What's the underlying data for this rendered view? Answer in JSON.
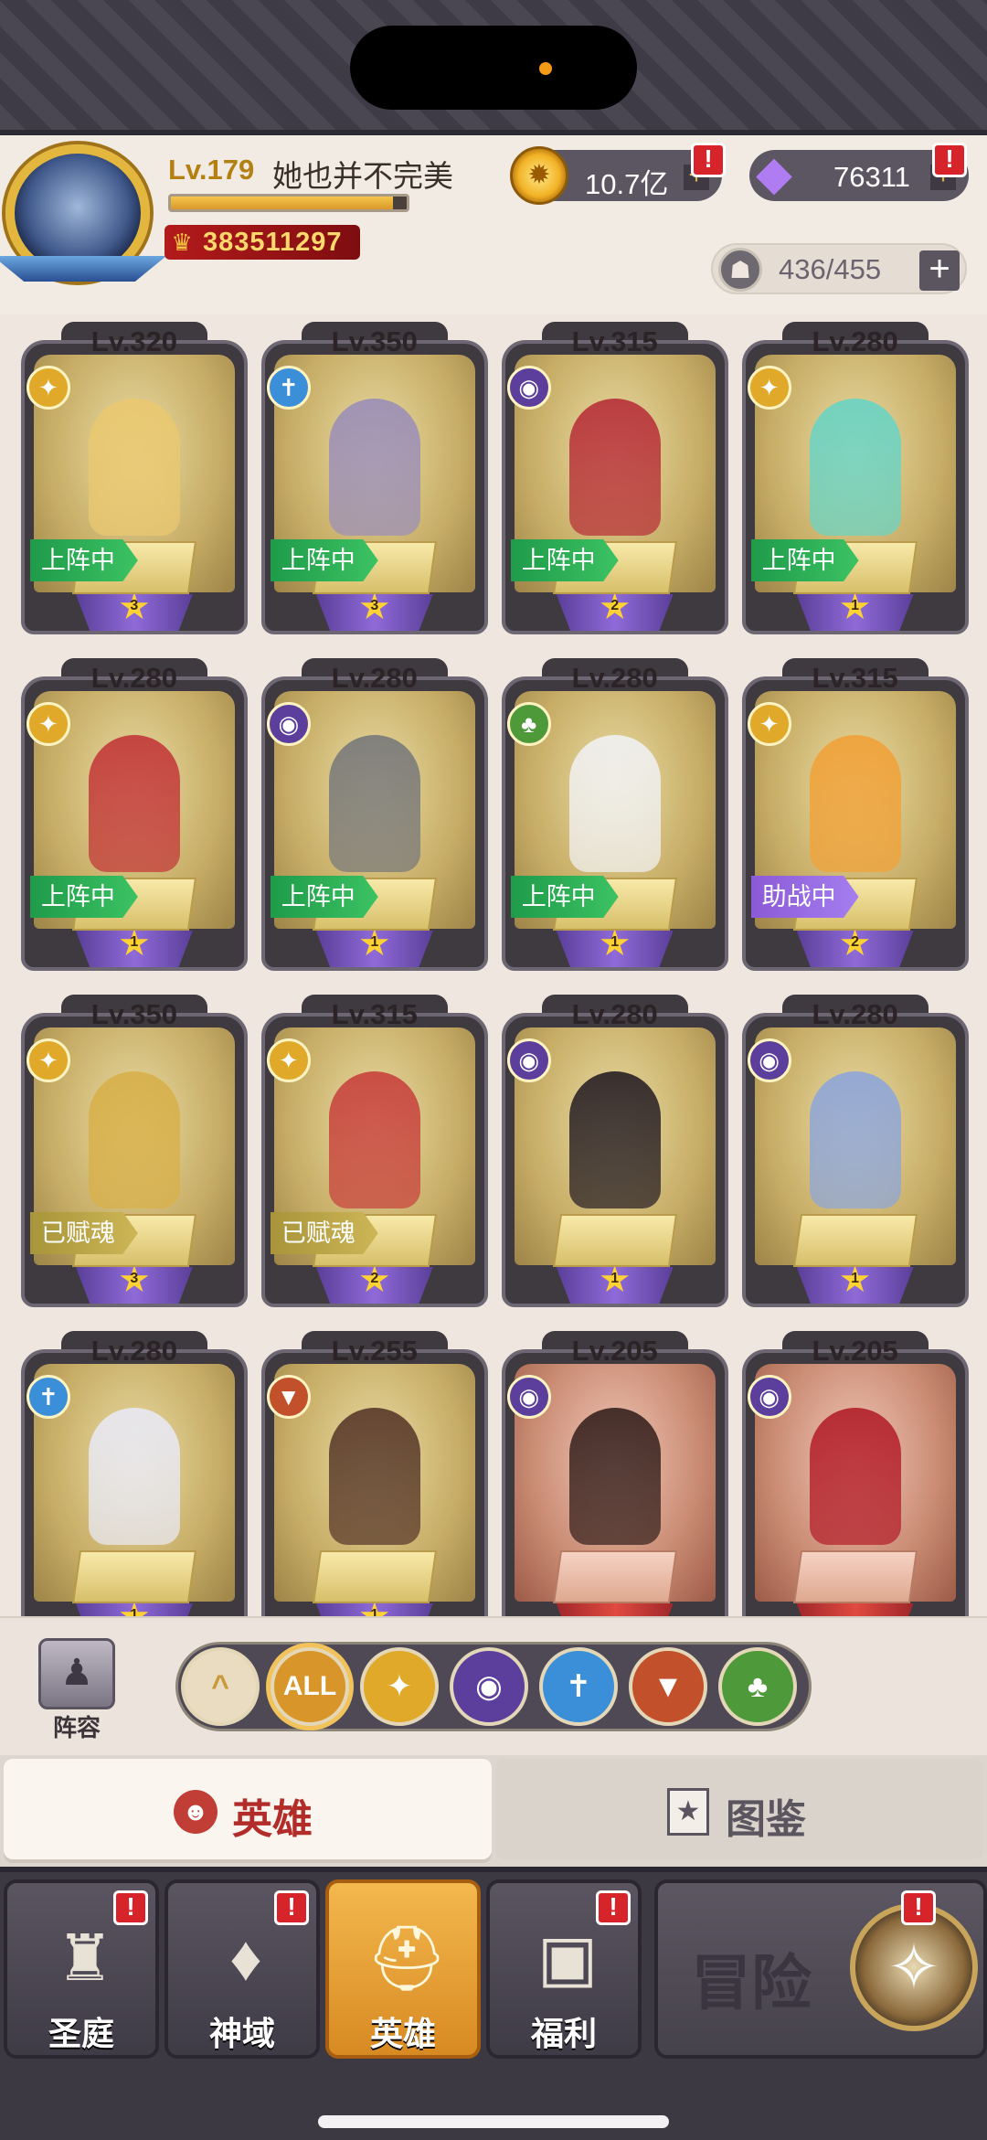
{
  "player": {
    "level": "Lv.179",
    "name": "她也并不完美",
    "power": "383511297",
    "xp_fraction": 0.94
  },
  "currency": {
    "gold": "10.7亿",
    "gems": "76311",
    "gold_alert": "!",
    "gems_alert": "!"
  },
  "hero_slots": "436/455",
  "heroes": [
    {
      "level": "Lv.320",
      "element": "light",
      "status": "上阵中",
      "status_kind": "deployed",
      "stars": "3",
      "frame": "gold",
      "color": "#e9c870"
    },
    {
      "level": "Lv.350",
      "element": "holy",
      "status": "上阵中",
      "status_kind": "deployed",
      "stars": "3",
      "frame": "gold",
      "color": "#9c8fb7"
    },
    {
      "level": "Lv.315",
      "element": "dark",
      "status": "上阵中",
      "status_kind": "deployed",
      "stars": "2",
      "frame": "gold",
      "color": "#b8323a"
    },
    {
      "level": "Lv.280",
      "element": "light",
      "status": "上阵中",
      "status_kind": "deployed",
      "stars": "1",
      "frame": "gold",
      "color": "#6bd3c3"
    },
    {
      "level": "Lv.280",
      "element": "light",
      "status": "上阵中",
      "status_kind": "deployed",
      "stars": "1",
      "frame": "gold",
      "color": "#c33a3a"
    },
    {
      "level": "Lv.280",
      "element": "dark",
      "status": "上阵中",
      "status_kind": "deployed",
      "stars": "1",
      "frame": "gold",
      "color": "#7a7a7a"
    },
    {
      "level": "Lv.280",
      "element": "nature",
      "status": "上阵中",
      "status_kind": "deployed",
      "stars": "1",
      "frame": "gold",
      "color": "#f0f0f0"
    },
    {
      "level": "Lv.315",
      "element": "light",
      "status": "助战中",
      "status_kind": "assist",
      "stars": "2",
      "frame": "gold",
      "color": "#f0a23a"
    },
    {
      "level": "Lv.350",
      "element": "light",
      "status": "已赋魂",
      "status_kind": "soul",
      "stars": "3",
      "frame": "gold",
      "color": "#d8b04a"
    },
    {
      "level": "Lv.315",
      "element": "light",
      "status": "已赋魂",
      "status_kind": "soul",
      "stars": "2",
      "frame": "gold",
      "color": "#c8443e"
    },
    {
      "level": "Lv.280",
      "element": "dark",
      "status": "",
      "status_kind": "none",
      "stars": "1",
      "frame": "gold",
      "color": "#2b2226"
    },
    {
      "level": "Lv.280",
      "element": "dark",
      "status": "",
      "status_kind": "none",
      "stars": "1",
      "frame": "gold",
      "color": "#8fa6d8"
    },
    {
      "level": "Lv.280",
      "element": "holy",
      "status": "",
      "status_kind": "none",
      "stars": "1",
      "frame": "gold",
      "color": "#e8e8f2"
    },
    {
      "level": "Lv.255",
      "element": "beast",
      "status": "",
      "status_kind": "none",
      "stars": "1",
      "frame": "gold",
      "color": "#5a3b2b"
    },
    {
      "level": "Lv.205",
      "element": "dark",
      "status": "",
      "status_kind": "none",
      "stars": "",
      "frame": "red",
      "color": "#3a2420"
    },
    {
      "level": "Lv.205",
      "element": "dark",
      "status": "",
      "status_kind": "none",
      "stars": "",
      "frame": "red",
      "color": "#b4222c"
    }
  ],
  "elements": {
    "light": {
      "icon": "light-element-icon",
      "color": "#e0a92a",
      "glyph": "✦"
    },
    "holy": {
      "icon": "holy-element-icon",
      "color": "#3a8fd8",
      "glyph": "✝"
    },
    "dark": {
      "icon": "dark-element-icon",
      "color": "#5c3e9c",
      "glyph": "◉"
    },
    "nature": {
      "icon": "nature-element-icon",
      "color": "#4e9a3a",
      "glyph": "♣"
    },
    "beast": {
      "icon": "beast-element-icon",
      "color": "#c2502a",
      "glyph": "▼"
    }
  },
  "filter": {
    "lineup_label": "阵容",
    "buttons": [
      {
        "name": "collapse-filter-button",
        "label": "^",
        "color": "#e9dcc0",
        "fg": "#c99a3a"
      },
      {
        "name": "filter-all-button",
        "label": "ALL",
        "color": "#d8962a",
        "fg": "#fff"
      },
      {
        "name": "filter-light-button",
        "label": "✦",
        "color": "#e0a92a",
        "fg": "#fff"
      },
      {
        "name": "filter-dark-button",
        "label": "◉",
        "color": "#5c3e9c",
        "fg": "#fff"
      },
      {
        "name": "filter-holy-button",
        "label": "✝",
        "color": "#3a8fd8",
        "fg": "#fff"
      },
      {
        "name": "filter-beast-button",
        "label": "▼",
        "color": "#c2502a",
        "fg": "#fff"
      },
      {
        "name": "filter-nature-button",
        "label": "♣",
        "color": "#4e9a3a",
        "fg": "#fff"
      }
    ]
  },
  "tabs": {
    "heroes": "英雄",
    "collection": "图鉴"
  },
  "nav": {
    "items": [
      {
        "label": "圣庭",
        "icon": "sanctum-icon",
        "glyph": "♜",
        "alert": "!"
      },
      {
        "label": "神域",
        "icon": "divine-realm-icon",
        "glyph": "♦",
        "alert": "!"
      },
      {
        "label": "英雄",
        "icon": "hero-helmet-icon",
        "glyph": "⛑",
        "alert": ""
      },
      {
        "label": "福利",
        "icon": "treasure-chest-icon",
        "glyph": "▣",
        "alert": "!"
      }
    ],
    "adventure": "冒险",
    "adventure_alert": "!"
  }
}
